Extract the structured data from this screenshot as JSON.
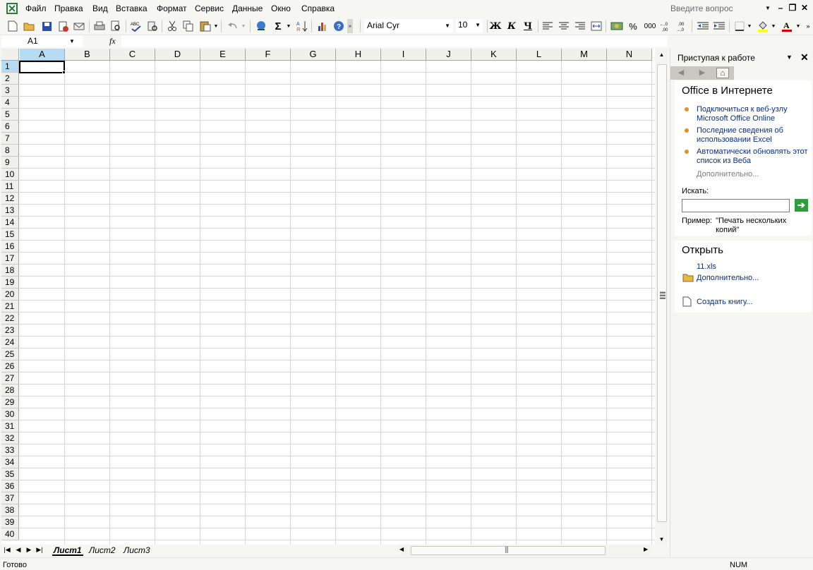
{
  "menu": {
    "items": [
      {
        "label": "Файл"
      },
      {
        "label": "Правка"
      },
      {
        "label": "Вид"
      },
      {
        "label": "Вставка"
      },
      {
        "label": "Формат"
      },
      {
        "label": "Сервис"
      },
      {
        "label": "Данные"
      },
      {
        "label": "Окно"
      },
      {
        "label": "Справка"
      }
    ],
    "help_placeholder": "Введите вопрос"
  },
  "toolbar": {
    "font_name": "Arial Cyr",
    "font_size": "10",
    "bold_label": "Ж",
    "italic_label": "К",
    "underline_label": "Ч",
    "percent_label": "%",
    "thousands_label": "000",
    "sigma_label": "Σ",
    "font_color": "#d00000",
    "fill_color": "#ffff00"
  },
  "formula_bar": {
    "name_box": "A1",
    "fx_label": "fx",
    "formula_value": ""
  },
  "grid": {
    "columns": [
      "A",
      "B",
      "C",
      "D",
      "E",
      "F",
      "G",
      "H",
      "I",
      "J",
      "K",
      "L",
      "M",
      "N"
    ],
    "rows": [
      "1",
      "2",
      "3",
      "4",
      "5",
      "6",
      "7",
      "8",
      "9",
      "10",
      "11",
      "12",
      "13",
      "14",
      "15",
      "16",
      "17",
      "18",
      "19",
      "20",
      "21",
      "22",
      "23",
      "24",
      "25",
      "26",
      "27",
      "28",
      "29",
      "30",
      "31",
      "32",
      "33",
      "34",
      "35",
      "36",
      "37",
      "38",
      "39",
      "40"
    ],
    "active_cell": "A1"
  },
  "sheets": {
    "tabs": [
      {
        "label": "Лист1"
      },
      {
        "label": "Лист2"
      },
      {
        "label": "Лист3"
      }
    ],
    "active": "Лист1"
  },
  "task_pane": {
    "title": "Приступая к работе",
    "office_online_heading": "Office в Интернете",
    "links": [
      {
        "text": "Подключиться к веб-узлу Microsoft Office Online"
      },
      {
        "text": "Последние сведения об использовании Excel"
      },
      {
        "text": "Автоматически обновлять этот список из Веба"
      }
    ],
    "more_link": "Дополнительно...",
    "search_label": "Искать:",
    "search_value": "",
    "example_label": "Пример:",
    "example_text": "\"Печать нескольких копий\"",
    "open_heading": "Открыть",
    "recent_file": "11.xls",
    "open_more": "Дополнительно...",
    "new_workbook": "Создать книгу..."
  },
  "status": {
    "text": "Готово",
    "num_indicator": "NUM"
  }
}
